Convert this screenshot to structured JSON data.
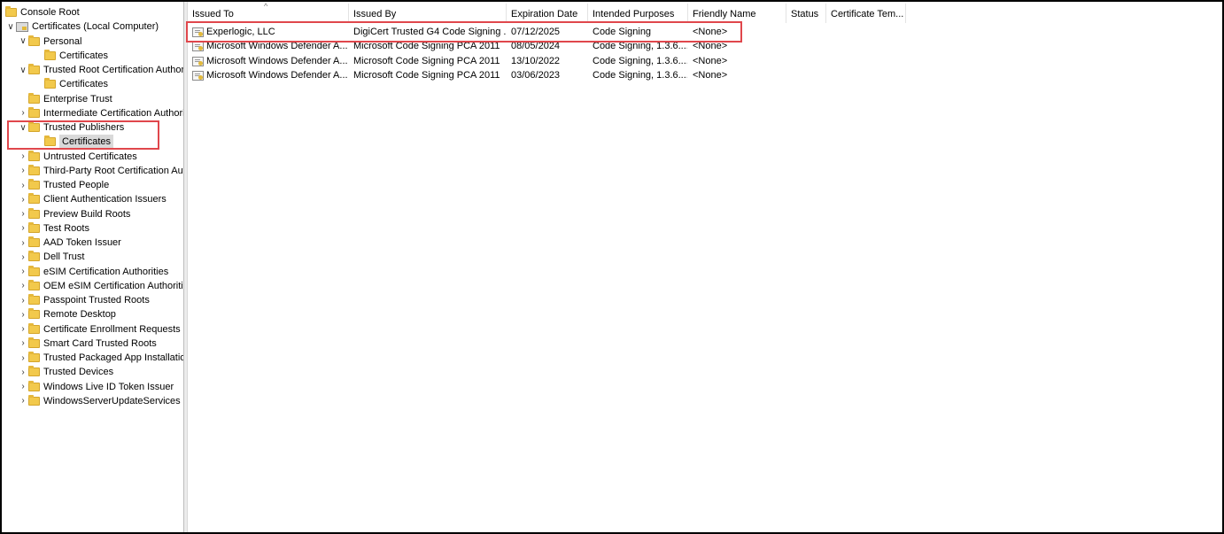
{
  "tree": {
    "items": [
      {
        "label": "Console Root",
        "level": 0,
        "icon": "folder-icon",
        "expander": "none"
      },
      {
        "label": "Certificates (Local Computer)",
        "level": 0,
        "icon": "certificate-store-icon",
        "expander": "expanded"
      },
      {
        "label": "Personal",
        "level": 1,
        "icon": "folder-icon",
        "expander": "expanded"
      },
      {
        "label": "Certificates",
        "level": 2,
        "icon": "folder-icon",
        "expander": "none"
      },
      {
        "label": "Trusted Root Certification Authorities",
        "level": 1,
        "icon": "folder-icon",
        "expander": "expanded"
      },
      {
        "label": "Certificates",
        "level": 2,
        "icon": "folder-icon",
        "expander": "none"
      },
      {
        "label": "Enterprise Trust",
        "level": 1,
        "icon": "folder-icon",
        "expander": "none"
      },
      {
        "label": "Intermediate Certification Authorities",
        "level": 1,
        "icon": "folder-icon",
        "expander": "collapsed"
      },
      {
        "label": "Trusted Publishers",
        "level": 1,
        "icon": "folder-icon",
        "expander": "expanded"
      },
      {
        "label": "Certificates",
        "level": 2,
        "icon": "folder-icon",
        "expander": "none",
        "selected": true
      },
      {
        "label": "Untrusted Certificates",
        "level": 1,
        "icon": "folder-icon",
        "expander": "collapsed"
      },
      {
        "label": "Third-Party Root Certification Authorities",
        "level": 1,
        "icon": "folder-icon",
        "expander": "collapsed"
      },
      {
        "label": "Trusted People",
        "level": 1,
        "icon": "folder-icon",
        "expander": "collapsed"
      },
      {
        "label": "Client Authentication Issuers",
        "level": 1,
        "icon": "folder-icon",
        "expander": "collapsed"
      },
      {
        "label": "Preview Build Roots",
        "level": 1,
        "icon": "folder-icon",
        "expander": "collapsed"
      },
      {
        "label": "Test Roots",
        "level": 1,
        "icon": "folder-icon",
        "expander": "collapsed"
      },
      {
        "label": "AAD Token Issuer",
        "level": 1,
        "icon": "folder-icon",
        "expander": "collapsed"
      },
      {
        "label": "Dell Trust",
        "level": 1,
        "icon": "folder-icon",
        "expander": "collapsed"
      },
      {
        "label": "eSIM Certification Authorities",
        "level": 1,
        "icon": "folder-icon",
        "expander": "collapsed"
      },
      {
        "label": "OEM eSIM Certification Authorities",
        "level": 1,
        "icon": "folder-icon",
        "expander": "collapsed"
      },
      {
        "label": "Passpoint Trusted Roots",
        "level": 1,
        "icon": "folder-icon",
        "expander": "collapsed"
      },
      {
        "label": "Remote Desktop",
        "level": 1,
        "icon": "folder-icon",
        "expander": "collapsed"
      },
      {
        "label": "Certificate Enrollment Requests",
        "level": 1,
        "icon": "folder-icon",
        "expander": "collapsed"
      },
      {
        "label": "Smart Card Trusted Roots",
        "level": 1,
        "icon": "folder-icon",
        "expander": "collapsed"
      },
      {
        "label": "Trusted Packaged App Installation Authorities",
        "level": 1,
        "icon": "folder-icon",
        "expander": "collapsed"
      },
      {
        "label": "Trusted Devices",
        "level": 1,
        "icon": "folder-icon",
        "expander": "collapsed"
      },
      {
        "label": "Windows Live ID Token Issuer",
        "level": 1,
        "icon": "folder-icon",
        "expander": "collapsed"
      },
      {
        "label": "WindowsServerUpdateServices",
        "level": 1,
        "icon": "folder-icon",
        "expander": "collapsed"
      }
    ]
  },
  "list": {
    "columns": [
      "Issued To",
      "Issued By",
      "Expiration Date",
      "Intended Purposes",
      "Friendly Name",
      "Status",
      "Certificate Tem..."
    ],
    "rows": [
      [
        "Experlogic, LLC",
        "DigiCert Trusted G4 Code Signing ...",
        "07/12/2025",
        "Code Signing",
        "<None>",
        "",
        ""
      ],
      [
        "Microsoft Windows Defender A...",
        "Microsoft Code Signing PCA 2011",
        "08/05/2024",
        "Code Signing, 1.3.6....",
        "<None>",
        "",
        ""
      ],
      [
        "Microsoft Windows Defender A...",
        "Microsoft Code Signing PCA 2011",
        "13/10/2022",
        "Code Signing, 1.3.6....",
        "<None>",
        "",
        ""
      ],
      [
        "Microsoft Windows Defender A...",
        "Microsoft Code Signing PCA 2011",
        "03/06/2023",
        "Code Signing, 1.3.6....",
        "<None>",
        "",
        ""
      ]
    ]
  },
  "colors": {
    "highlight": "#e0474c",
    "selection": "#d9d9d9",
    "folder": "#f2c94c"
  }
}
